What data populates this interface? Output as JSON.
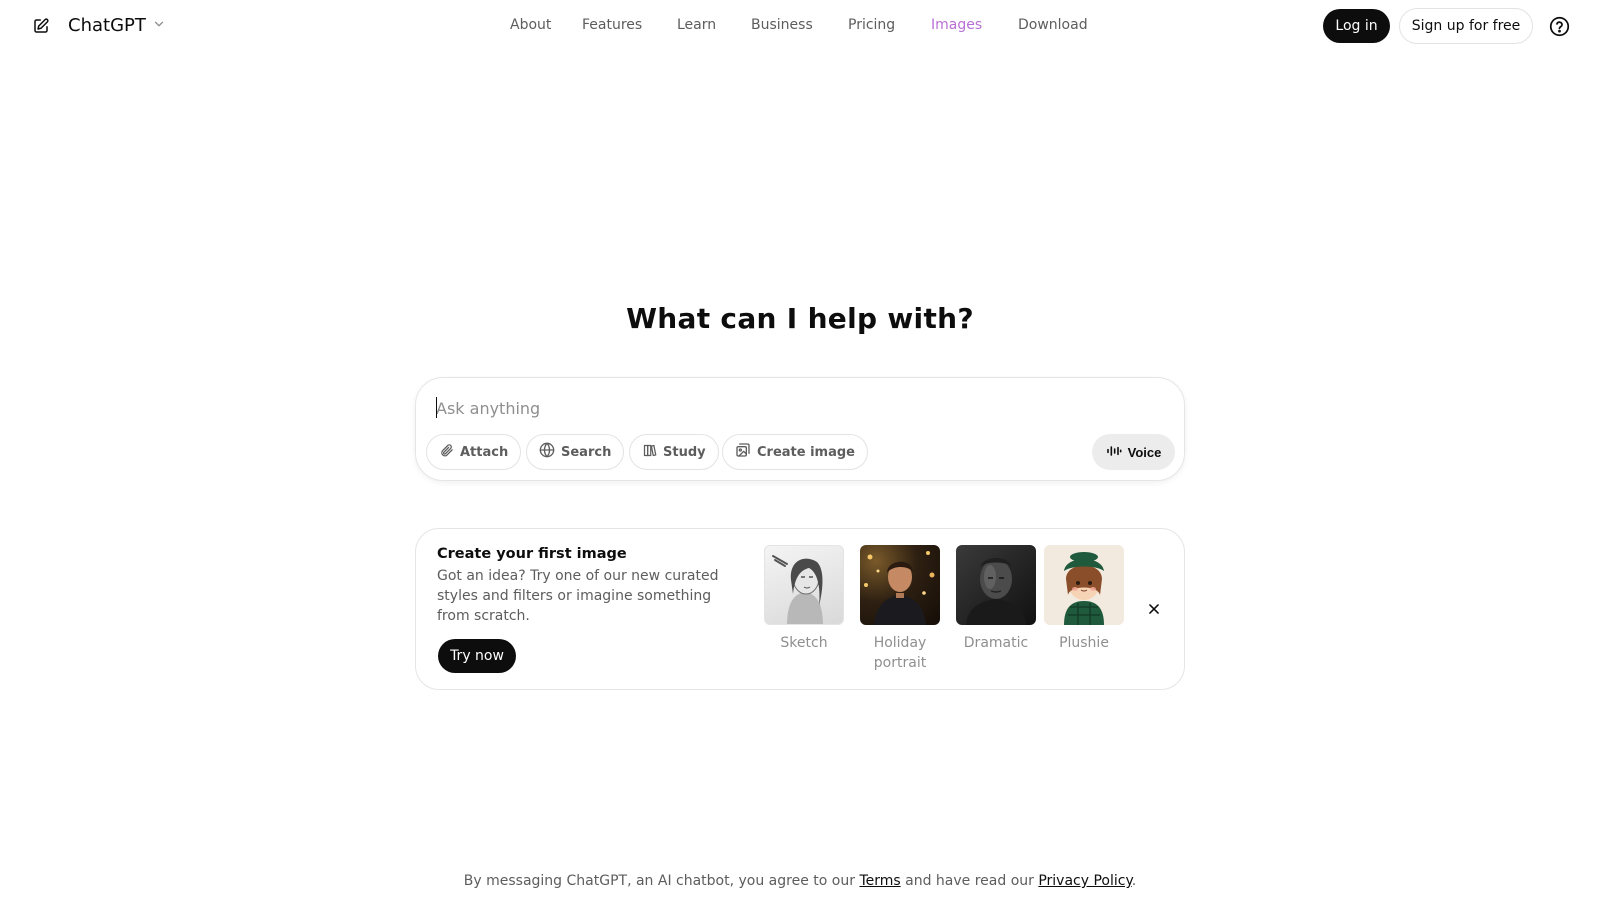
{
  "header": {
    "model_name": "ChatGPT",
    "nav": [
      {
        "label": "About",
        "active": false
      },
      {
        "label": "Features",
        "active": false
      },
      {
        "label": "Learn",
        "active": false
      },
      {
        "label": "Business",
        "active": false
      },
      {
        "label": "Pricing",
        "active": false
      },
      {
        "label": "Images",
        "active": true
      },
      {
        "label": "Download",
        "active": false
      }
    ],
    "login_label": "Log in",
    "signup_label": "Sign up for free"
  },
  "main": {
    "headline": "What can I help with?",
    "composer": {
      "placeholder": "Ask anything",
      "tools": [
        {
          "label": "Attach",
          "icon": "paperclip-icon"
        },
        {
          "label": "Search",
          "icon": "globe-icon"
        },
        {
          "label": "Study",
          "icon": "book-icon"
        },
        {
          "label": "Create image",
          "icon": "image-icon"
        }
      ],
      "voice_label": "Voice"
    },
    "promo": {
      "title": "Create your first image",
      "description": "Got an idea? Try one of our new curated styles and filters or imagine something from scratch.",
      "cta_label": "Try now",
      "styles": [
        {
          "label": "Sketch"
        },
        {
          "label": "Holiday portrait"
        },
        {
          "label": "Dramatic"
        },
        {
          "label": "Plushie"
        }
      ]
    }
  },
  "footer": {
    "text_before": "By messaging ChatGPT, an AI chatbot, you agree to our ",
    "terms_label": "Terms",
    "text_middle": " and have read our ",
    "privacy_label": "Privacy Policy",
    "text_after": "."
  },
  "colors": {
    "accent_active_nav": "#b86fd6",
    "primary_button": "#0d0d0d",
    "muted_text": "#5d5d5d"
  }
}
